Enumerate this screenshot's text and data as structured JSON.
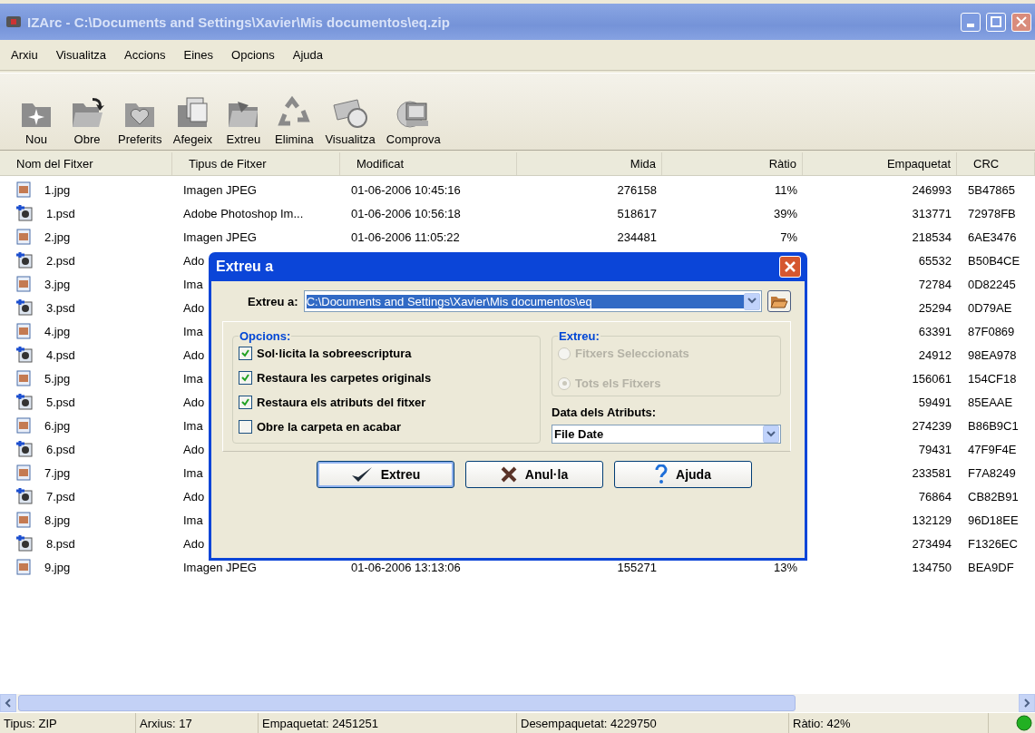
{
  "window": {
    "title": "IZArc - C:\\Documents and Settings\\Xavier\\Mis documentos\\eq.zip"
  },
  "menu": [
    "Arxiu",
    "Visualitza",
    "Accions",
    "Eines",
    "Opcions",
    "Ajuda"
  ],
  "toolbar": [
    {
      "kind": "new",
      "label": "Nou"
    },
    {
      "kind": "open",
      "label": "Obre"
    },
    {
      "kind": "favorites",
      "label": "Preferits"
    },
    {
      "kind": "add",
      "label": "Afegeix"
    },
    {
      "kind": "extract",
      "label": "Extreu"
    },
    {
      "kind": "delete",
      "label": "Elimina"
    },
    {
      "kind": "view",
      "label": "Visualitza"
    },
    {
      "kind": "check",
      "label": "Comprova"
    }
  ],
  "table": {
    "columns": [
      "Nom del Fitxer",
      "Tipus de Fitxer",
      "Modificat",
      "Mida",
      "Ràtio",
      "Empaquetat",
      "CRC"
    ],
    "rows": [
      {
        "kind": "jpg",
        "name": "1.jpg",
        "type": "Imagen JPEG",
        "modified": "01-06-2006 10:45:16",
        "size": "276158",
        "ratio": "11%",
        "packed": "246993",
        "crc": "5B47865"
      },
      {
        "kind": "psd",
        "name": "1.psd",
        "type": "Adobe Photoshop Im...",
        "modified": "01-06-2006 10:56:18",
        "size": "518617",
        "ratio": "39%",
        "packed": "313771",
        "crc": "72978FB"
      },
      {
        "kind": "jpg",
        "name": "2.jpg",
        "type": "Imagen JPEG",
        "modified": "01-06-2006 11:05:22",
        "size": "234481",
        "ratio": "7%",
        "packed": "218534",
        "crc": "6AE3476"
      },
      {
        "kind": "psd",
        "name": "2.psd",
        "type": "Ado",
        "packed": "65532",
        "crc": "B50B4CE"
      },
      {
        "kind": "jpg",
        "name": "3.jpg",
        "type": "Ima",
        "packed": "72784",
        "crc": "0D82245"
      },
      {
        "kind": "psd",
        "name": "3.psd",
        "type": "Ado",
        "packed": "25294",
        "crc": "0D79AE"
      },
      {
        "kind": "jpg",
        "name": "4.jpg",
        "type": "Ima",
        "packed": "63391",
        "crc": "87F0869"
      },
      {
        "kind": "psd",
        "name": "4.psd",
        "type": "Ado",
        "packed": "24912",
        "crc": "98EA978"
      },
      {
        "kind": "jpg",
        "name": "5.jpg",
        "type": "Ima",
        "packed": "156061",
        "crc": "154CF18"
      },
      {
        "kind": "psd",
        "name": "5.psd",
        "type": "Ado",
        "packed": "59491",
        "crc": "85EAAE"
      },
      {
        "kind": "jpg",
        "name": "6.jpg",
        "type": "Ima",
        "packed": "274239",
        "crc": "B86B9C1"
      },
      {
        "kind": "psd",
        "name": "6.psd",
        "type": "Ado",
        "packed": "79431",
        "crc": "47F9F4E"
      },
      {
        "kind": "jpg",
        "name": "7.jpg",
        "type": "Ima",
        "packed": "233581",
        "crc": "F7A8249"
      },
      {
        "kind": "psd",
        "name": "7.psd",
        "type": "Ado",
        "packed": "76864",
        "crc": "CB82B91"
      },
      {
        "kind": "jpg",
        "name": "8.jpg",
        "type": "Ima",
        "packed": "132129",
        "crc": "96D18EE"
      },
      {
        "kind": "psd",
        "name": "8.psd",
        "type": "Ado",
        "packed": "273494",
        "crc": "F1326EC"
      },
      {
        "kind": "jpg",
        "name": "9.jpg",
        "type": "Imagen JPEG",
        "modified": "01-06-2006 13:13:06",
        "size": "155271",
        "ratio": "13%",
        "packed": "134750",
        "crc": "BEA9DF"
      }
    ]
  },
  "status_bar": [
    "Tipus: ZIP",
    "Arxius: 17",
    "Empaquetat: 2451251",
    "Desempaquetat: 4229750",
    "Ràtio: 42%"
  ],
  "dialog": {
    "title": "Extreu a",
    "path_label": "Extreu a:",
    "path_value": "C:\\Documents and Settings\\Xavier\\Mis documentos\\eq",
    "options_title": "Opcions:",
    "options": [
      {
        "label": "Sol·licita la sobreescriptura",
        "checked": true
      },
      {
        "label": "Restaura les carpetes originals",
        "checked": true
      },
      {
        "label": "Restaura els atributs del fitxer",
        "checked": true
      },
      {
        "label": "Obre la carpeta en acabar",
        "checked": false
      }
    ],
    "extract_title": "Extreu:",
    "extract": [
      {
        "label": "Fitxers Seleccionats",
        "selected": false,
        "disabled": true
      },
      {
        "label": "Tots els Fitxers",
        "selected": true,
        "disabled": true
      }
    ],
    "date_label": "Data dels Atributs:",
    "date_value": "File Date",
    "buttons": [
      {
        "kind": "ok",
        "label": "Extreu"
      },
      {
        "kind": "cancel",
        "label": "Anul·la"
      },
      {
        "kind": "help",
        "label": "Ajuda"
      }
    ]
  }
}
